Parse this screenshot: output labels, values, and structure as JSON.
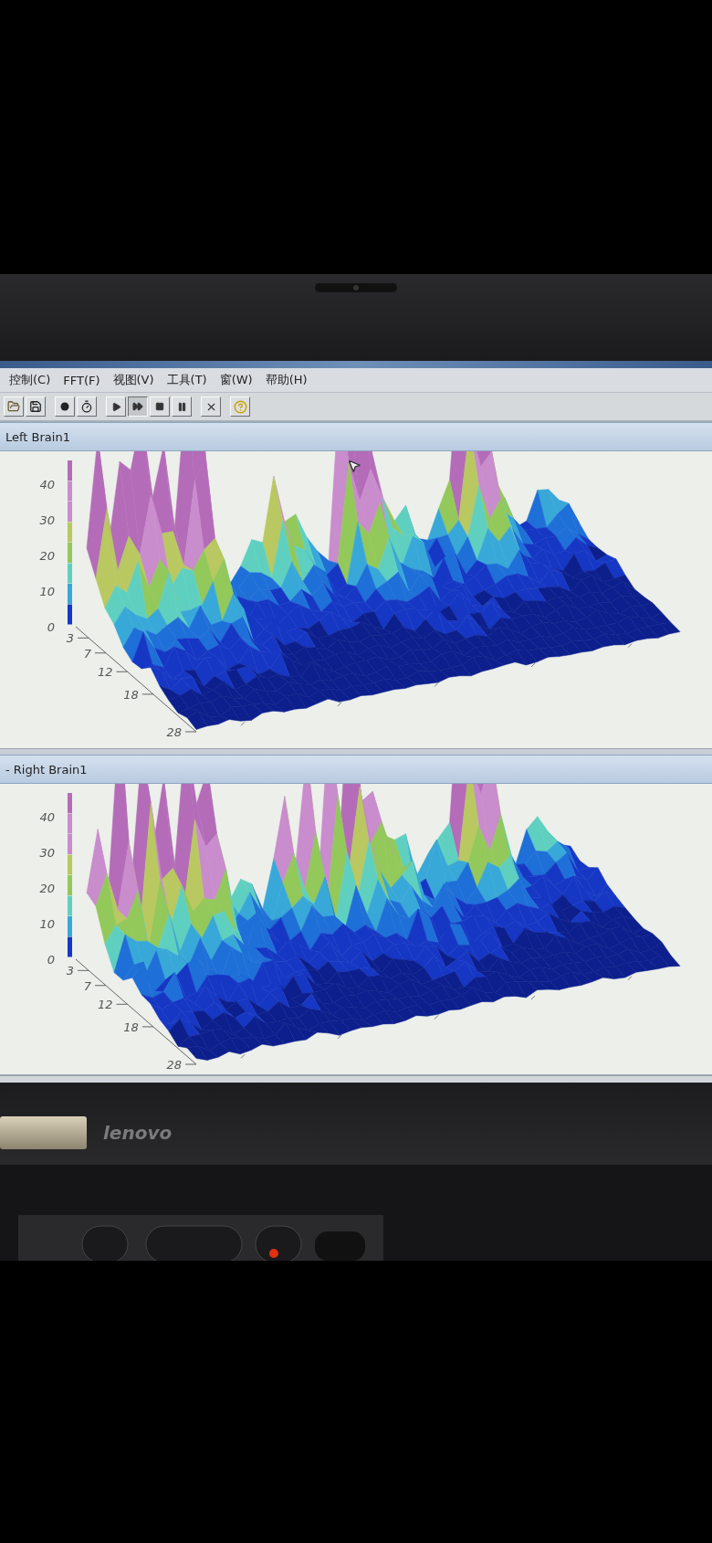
{
  "menu": [
    "控制(C)",
    "FFT(F)",
    "视图(V)",
    "工具(T)",
    "窗(W)",
    "帮助(H)"
  ],
  "toolbar": [
    {
      "kind": "open",
      "pressed": false
    },
    {
      "kind": "save",
      "pressed": false
    },
    {
      "kind": "separator"
    },
    {
      "kind": "record",
      "pressed": false
    },
    {
      "kind": "timer",
      "pressed": false
    },
    {
      "kind": "separator"
    },
    {
      "kind": "play",
      "pressed": false
    },
    {
      "kind": "fast_forward",
      "pressed": true
    },
    {
      "kind": "stop",
      "pressed": false
    },
    {
      "kind": "pause",
      "pressed": false
    },
    {
      "kind": "separator"
    },
    {
      "kind": "close",
      "pressed": false
    },
    {
      "kind": "separator"
    },
    {
      "kind": "help",
      "pressed": false
    }
  ],
  "panels": [
    {
      "title": "Left Brain1",
      "z_ticks": [
        "40",
        "30",
        "20",
        "10",
        "0"
      ],
      "frequency_ticks": [
        "3",
        "7",
        "12",
        "18",
        "28"
      ],
      "cursor": true
    },
    {
      "title": "- Right Brain1",
      "z_ticks": [
        "40",
        "30",
        "20",
        "10",
        "0"
      ],
      "frequency_ticks": [
        "3",
        "7",
        "12",
        "18",
        "28"
      ],
      "cursor": false
    }
  ],
  "laptop": {
    "brand": "lenovo"
  }
}
